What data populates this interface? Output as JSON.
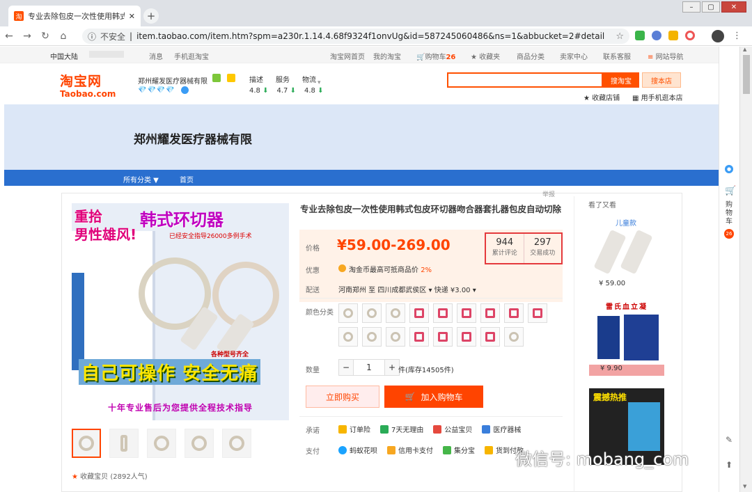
{
  "browser": {
    "tab_title": "专业去除包皮一次性使用韩式包皮",
    "tab_favicon": "淘",
    "secure_label": "不安全",
    "url": "item.taobao.com/item.htm?spm=a230r.1.14.4.68f9324f1onvUg&id=587245060486&ns=1&abbucket=2#detail"
  },
  "topnav": {
    "region": "中国大陆",
    "messages": "消息",
    "mobile_taobao": "手机逛淘宝",
    "home": "淘宝网首页",
    "my_taobao": "我的淘宝",
    "cart": "购物车",
    "cart_count": "26",
    "favorites": "收藏夹",
    "categories": "商品分类",
    "seller_center": "卖家中心",
    "service": "联系客服",
    "site_nav": "网站导航"
  },
  "header": {
    "logo_cn": "淘宝网",
    "logo_en": "Taobao.com",
    "shop_name": "郑州耀发医疗器械有限",
    "diamonds": "💎💎💎💎",
    "score_labels": [
      "描述",
      "服务",
      "物流"
    ],
    "score_values": [
      "4.8",
      "4.7",
      "4.8"
    ],
    "search_taobao_btn": "搜淘宝",
    "search_shop_btn": "搜本店",
    "fav_shop": "收藏店铺",
    "mobile_shop": "用手机逛本店"
  },
  "banner": {
    "title": "郑州耀发医疗器械有限"
  },
  "shopnav": {
    "all_categories": "所有分类 ▼",
    "home": "首页"
  },
  "product": {
    "report": "举报",
    "title": "专业去除包皮一次性使用韩式包皮环切器吻合器套扎器包皮自动切除",
    "price_label": "价格",
    "price": "¥59.00-269.00",
    "reviews_count": "944",
    "reviews_label": "累计评论",
    "sales_count": "297",
    "sales_label": "交易成功",
    "promo_label": "优惠",
    "promo_text": "淘金币最高可抵商品价",
    "promo_pct": "2%",
    "ship_label": "配送",
    "ship_text": "河南郑州 至   四川成都武侯区 ▾   快递 ¥3.00 ▾",
    "color_label": "颜色分类",
    "qty_label": "数量",
    "qty_value": "1",
    "qty_minus": "−",
    "qty_plus": "+",
    "stock": "件(库存14505件)",
    "buy_now": "立即购买",
    "add_cart": "加入购物车",
    "promise_label": "承诺",
    "promises": [
      "订单险",
      "7天无理由",
      "公益宝贝",
      "医疗器械"
    ],
    "pay_label": "支付",
    "pays": [
      "蚂蚁花呗",
      "信用卡支付",
      "集分宝",
      "货到付款"
    ],
    "fav_item": "收藏宝贝",
    "fav_pop": "(2892人气)"
  },
  "gallery": {
    "line1": "重拾",
    "line2": "男性雄风!",
    "headline": "韩式环切器",
    "safety": "已经安全指导26000多例手术",
    "models": "各种型号齐全",
    "big_a": "自己可操作",
    "big_b": "安全无痛",
    "bottom": "十年专业售后为您提供全程技术指导"
  },
  "side": {
    "heading": "看了又看",
    "rec1_label": "儿童款",
    "rec1_price": "¥ 59.00",
    "rec2_title": "雷氏血立凝",
    "rec2_price": "¥ 9.90",
    "rec3_title": "震撼热推"
  },
  "rightbar": {
    "cart_text": "购物车",
    "cart_count": "26"
  },
  "watermark": "微信号: mobang_com",
  "colors": {
    "accent": "#ff4400",
    "shop_nav": "#2a6fcf",
    "banner": "#dce7f7"
  }
}
